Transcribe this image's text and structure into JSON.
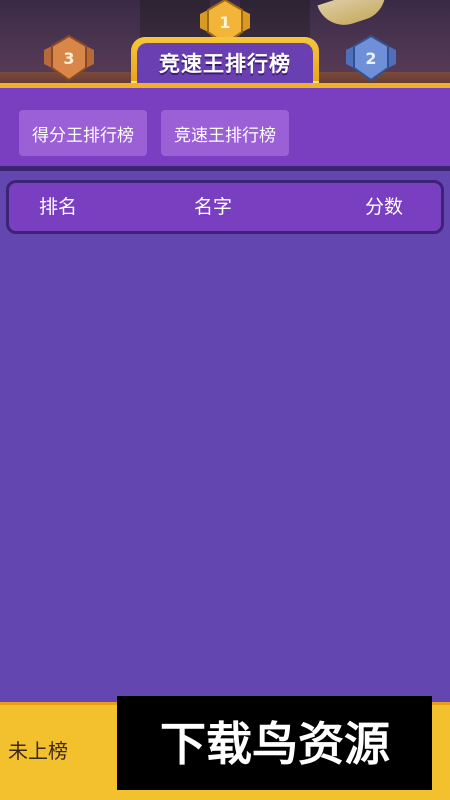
{
  "header": {
    "title": "竞速王排行榜"
  },
  "tabs": [
    {
      "label": "得分王排行榜"
    },
    {
      "label": "竞速王排行榜"
    }
  ],
  "table": {
    "columns": [
      "排名",
      "名字",
      "分数"
    ],
    "rows": []
  },
  "medals": [
    {
      "rank": "3",
      "color": "#d9864a"
    },
    {
      "rank": "1",
      "color": "#f2b53a"
    },
    {
      "rank": "2",
      "color": "#6f8fd8"
    }
  ],
  "footer": {
    "status": "未上榜"
  },
  "watermark": {
    "text": "下载鸟资源"
  },
  "colors": {
    "background": "#6446b0",
    "header_band": "#7a3ec0",
    "tab": "#9b5fd6",
    "accent_gold": "#f0b12a",
    "footer": "#f3c12e"
  }
}
